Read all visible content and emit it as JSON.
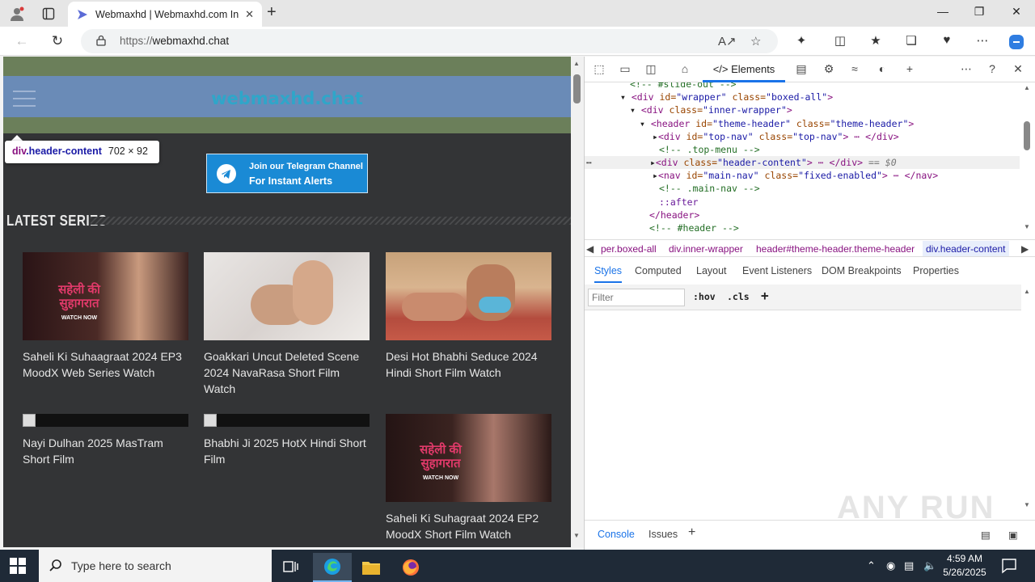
{
  "browser": {
    "tab_title": "Webmaxhd | Webmaxhd.com In",
    "url_scheme": "https://",
    "url_host": "webmaxhd.chat",
    "new_tab": "+",
    "tab_close": "✕"
  },
  "site": {
    "logo": "webmaxhd.chat",
    "telegram_line1": "Join our Telegram Channel",
    "telegram_line2": "For Instant Alerts",
    "section_title": "LATEST SERIES",
    "cards": [
      {
        "title": "Saheli Ki Suhaagraat 2024 EP3 MoodX Web Series Watch",
        "thumb_text": "सहेली की सुहागरात",
        "watch": "WATCH NOW"
      },
      {
        "title": "Goakkari Uncut Deleted Scene 2024 NavaRasa Short Film Watch"
      },
      {
        "title": "Desi Hot Bhabhi Seduce 2024 Hindi Short Film Watch"
      },
      {
        "title": "Nayi Dulhan 2025 MasTram Short Film"
      },
      {
        "title": "Bhabhi Ji 2025 HotX Hindi Short Film"
      },
      {
        "title": "Saheli Ki Suhagraat 2024 EP2 MoodX Short Film Watch",
        "thumb_text": "सहेली की सुहागरात",
        "watch": "WATCH NOW"
      }
    ]
  },
  "inspector_tooltip": {
    "tag": "div",
    "cls": ".header-content",
    "dims": "702 × 92"
  },
  "devtools": {
    "elements_tab": "Elements",
    "dom": {
      "l0": "<!-- #slide-out -->",
      "l1_tag": "<div",
      "l1_attr": " id=",
      "l1_val": "\"wrapper\"",
      "l1_attr2": " class=",
      "l1_val2": "\"boxed-all\"",
      "l1_end": ">",
      "l2_tag": "<div",
      "l2_attr": " class=",
      "l2_val": "\"inner-wrapper\"",
      "l2_end": ">",
      "l3_tag": "<header",
      "l3_attr": " id=",
      "l3_val": "\"theme-header\"",
      "l3_attr2": " class=",
      "l3_val2": "\"theme-header\"",
      "l3_end": ">",
      "l4_tag": "<div",
      "l4_attr": " id=",
      "l4_val": "\"top-nav\"",
      "l4_attr2": " class=",
      "l4_val2": "\"top-nav\"",
      "l4_end": "> ⋯ </div>",
      "l5": "<!-- .top-menu -->",
      "l6_tag": "<div",
      "l6_attr": " class=",
      "l6_val": "\"header-content\"",
      "l6_end": "> ⋯ </div>",
      "l6_eq": " == $0",
      "l7_tag": "<nav",
      "l7_attr": " id=",
      "l7_val": "\"main-nav\"",
      "l7_attr2": " class=",
      "l7_val2": "\"fixed-enabled\"",
      "l7_end": "> ⋯ </nav>",
      "l8": "<!-- .main-nav -->",
      "l9": "::after",
      "l10": "</header>",
      "l11": "<!-- #header -->"
    },
    "breadcrumbs": [
      "per.boxed-all",
      "div.inner-wrapper",
      "header#theme-header.theme-header",
      "div.header-content"
    ],
    "subtabs": [
      "Styles",
      "Computed",
      "Layout",
      "Event Listeners",
      "DOM Breakpoints",
      "Properties"
    ],
    "filter_placeholder": "Filter",
    "hov": ":hov",
    "cls": ".cls",
    "console_tabs": [
      "Console",
      "Issues"
    ],
    "watermark": "ANY RUN"
  },
  "taskbar": {
    "search_placeholder": "Type here to search",
    "time": "4:59 AM",
    "date": "5/26/2025"
  },
  "colors": {
    "page_bg": "#333436",
    "header_blue": "#6a8bb7",
    "header_green": "#6b7f5a",
    "logo": "#2fa6c9",
    "telegram": "#1a8ad5",
    "devtools_accent": "#1a73e8"
  }
}
